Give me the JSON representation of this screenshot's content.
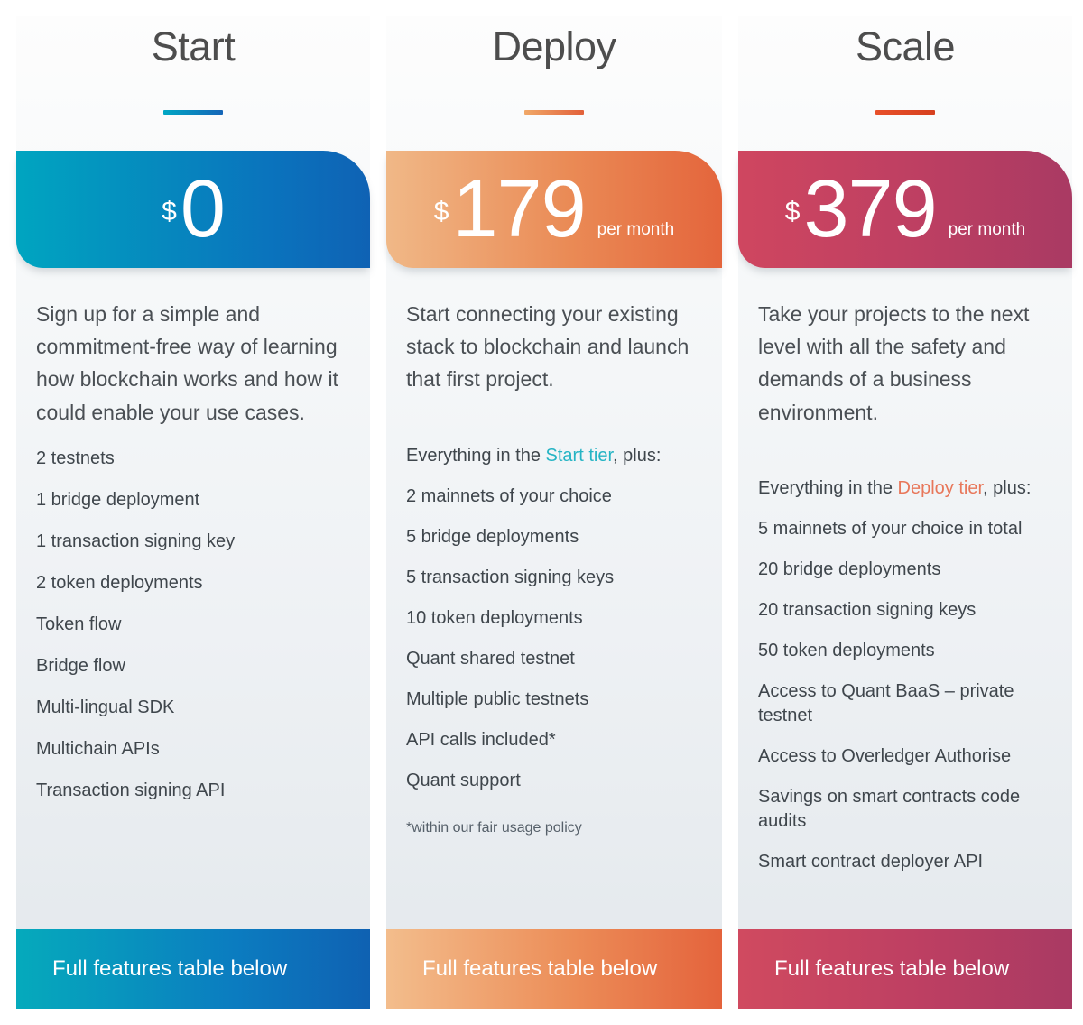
{
  "tiers": [
    {
      "name": "Start",
      "accent_color": "#00a7c4",
      "currency": "$",
      "price": "0",
      "per_unit": "",
      "description": "Sign up for a simple and commitment-free way of learning how blockchain works and how it could enable your use cases.",
      "plus_prefix": "",
      "plus_link": "",
      "plus_suffix": "",
      "features": [
        "2 testnets",
        "1 bridge deployment",
        "1 transaction signing key",
        "2 token deployments",
        "Token flow",
        "Bridge flow",
        "Multi-lingual SDK",
        "Multichain APIs",
        "Transaction signing API"
      ],
      "footnote": "",
      "footer_label": "Full features table below"
    },
    {
      "name": "Deploy",
      "accent_color": "#ea8a55",
      "currency": "$",
      "price": "179",
      "per_unit": "per month",
      "description": "Start connecting your existing stack to blockchain and launch that first project.",
      "plus_prefix": "Everything in the ",
      "plus_link": "Start tier",
      "plus_suffix": ", plus:",
      "features": [
        "2 mainnets of your choice",
        "5 bridge deployments",
        "5 transaction signing keys",
        "10 token deployments",
        "Quant shared testnet",
        "Multiple public testnets",
        "API calls included*",
        "Quant support"
      ],
      "footnote": "*within our fair usage policy",
      "footer_label": "Full features table below"
    },
    {
      "name": "Scale",
      "accent_color": "#d6401f",
      "currency": "$",
      "price": "379",
      "per_unit": "per month",
      "description": "Take your projects to the next level with all the safety and demands of a business environment.",
      "plus_prefix": "Everything in the ",
      "plus_link": "Deploy tier",
      "plus_suffix": ", plus:",
      "features": [
        "5 mainnets of your choice in total",
        "20 bridge deployments",
        "20 transaction signing keys",
        "50 token deployments",
        "Access to Quant BaaS – private testnet",
        "Access to Overledger Authorise",
        "Savings on smart contracts code audits",
        "Smart contract deployer API"
      ],
      "footnote": "",
      "footer_label": "Full features table below"
    }
  ]
}
